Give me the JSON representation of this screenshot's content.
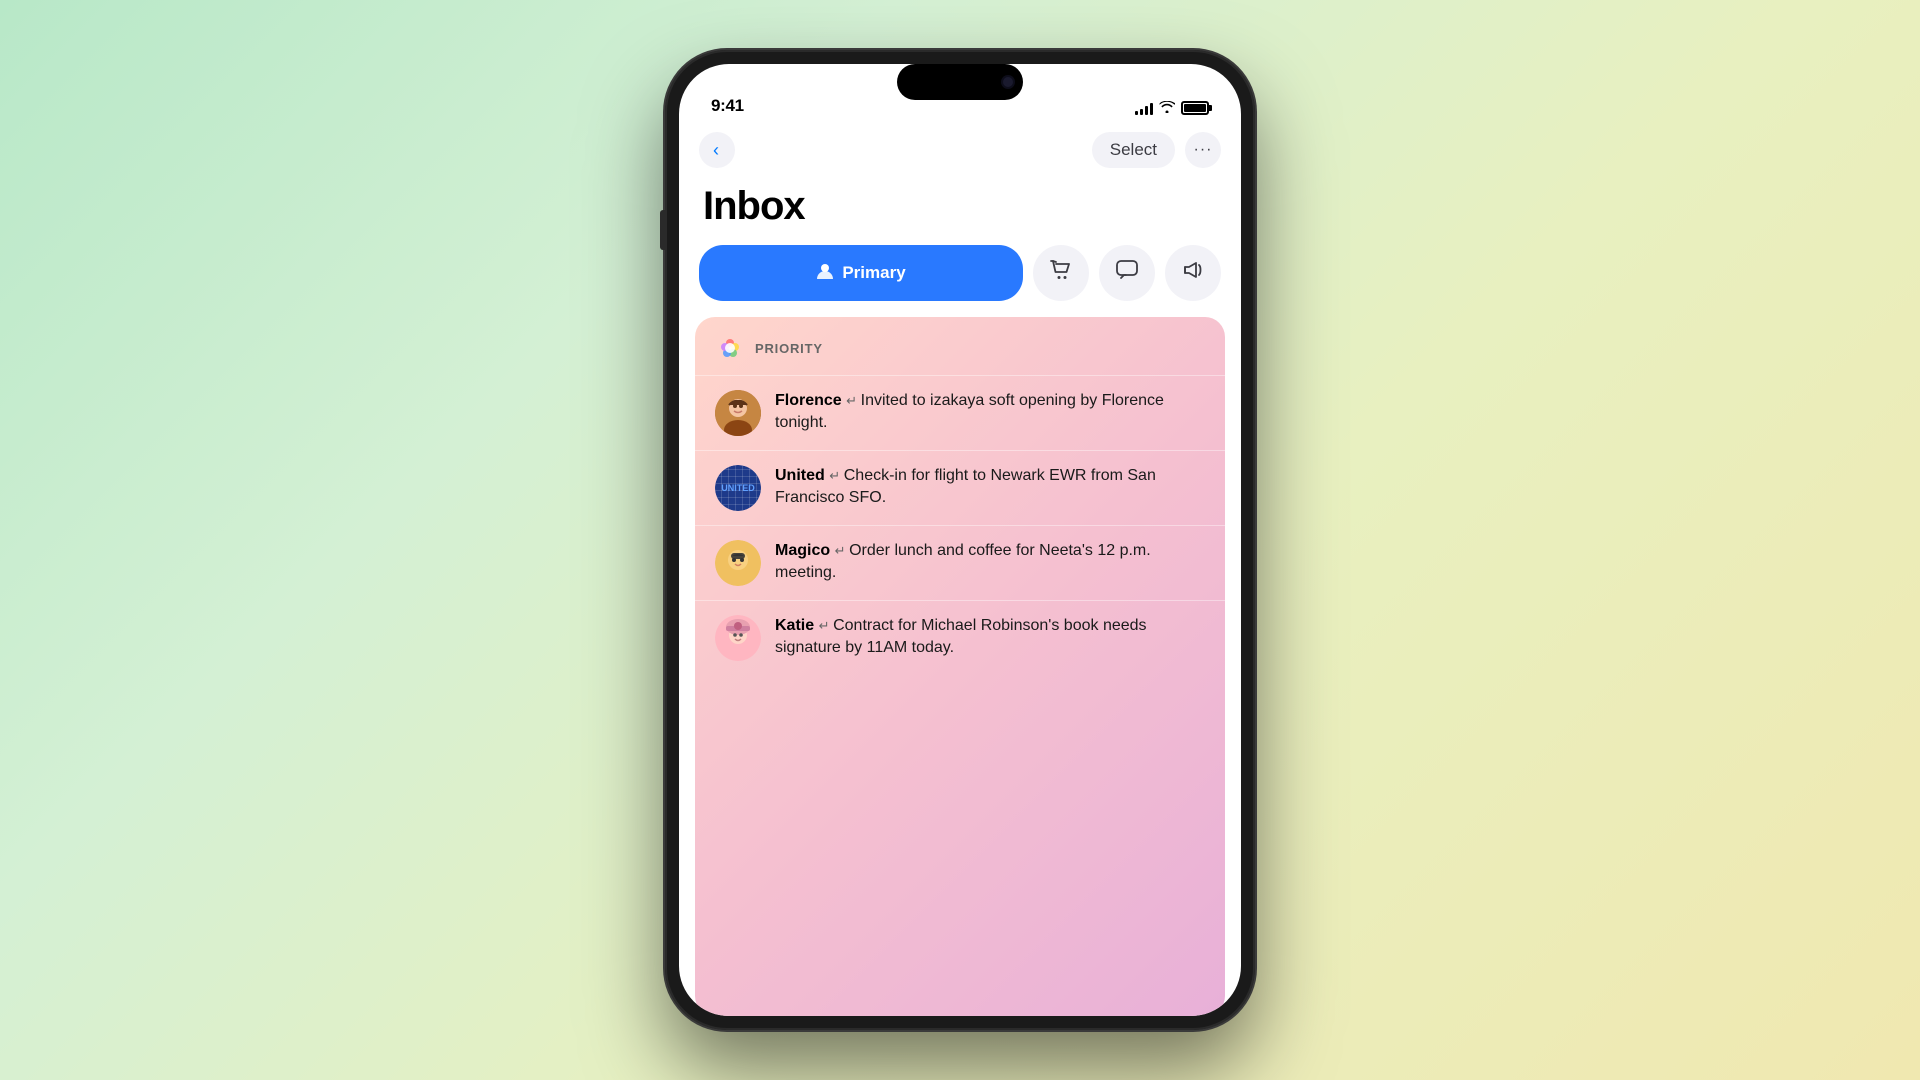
{
  "background": {
    "gradient": "linear-gradient(135deg, #b8e8c8, #e8f8c0, #f8f0a0)"
  },
  "status_bar": {
    "time": "9:41",
    "signal_bars": 4,
    "wifi": true,
    "battery": 100
  },
  "nav": {
    "back_label": "‹",
    "select_label": "Select",
    "more_label": "•••"
  },
  "page": {
    "title": "Inbox"
  },
  "tabs": [
    {
      "id": "primary",
      "label": "Primary",
      "active": true,
      "icon": "person"
    },
    {
      "id": "shopping",
      "label": "",
      "active": false,
      "icon": "cart"
    },
    {
      "id": "messages",
      "label": "",
      "active": false,
      "icon": "bubble"
    },
    {
      "id": "promotions",
      "label": "",
      "active": false,
      "icon": "megaphone"
    }
  ],
  "priority": {
    "section_label": "PRIORITY",
    "emails": [
      {
        "sender": "Florence",
        "preview": "Invited to izakaya soft opening by Florence tonight.",
        "avatar_type": "person_female"
      },
      {
        "sender": "United",
        "preview": "Check-in for flight to Newark EWR from San Francisco SFO.",
        "avatar_type": "globe"
      },
      {
        "sender": "Magico",
        "preview": "Order lunch and coffee for Neeta's 12 p.m. meeting.",
        "avatar_type": "memoji_mask"
      },
      {
        "sender": "Katie",
        "preview": "Contract for Michael Robinson's book needs signature by 11AM today.",
        "avatar_type": "memoji_beanie"
      }
    ]
  }
}
